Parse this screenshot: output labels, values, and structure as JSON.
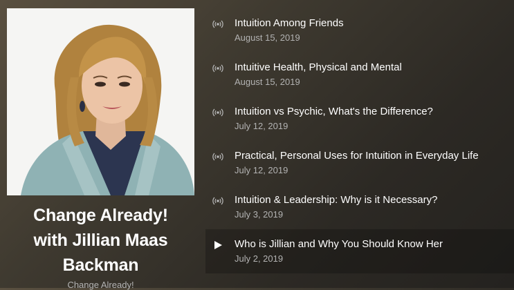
{
  "show": {
    "title_line1": "Change Already!",
    "title_line2": "with Jillian Maas",
    "title_line3": "Backman",
    "author": "Change Already!"
  },
  "episodes": [
    {
      "title": "Intuition Among Friends",
      "date": "August 15, 2019",
      "icon": "podcast-icon"
    },
    {
      "title": "Intuitive Health, Physical and Mental",
      "date": "August 15, 2019",
      "icon": "podcast-icon"
    },
    {
      "title": "Intuition vs Psychic, What's the Difference?",
      "date": "July 12, 2019",
      "icon": "podcast-icon"
    },
    {
      "title": "Practical, Personal Uses for Intuition in Everyday Life",
      "date": "July 12, 2019",
      "icon": "podcast-icon"
    },
    {
      "title": "Intuition & Leadership: Why is it Necessary?",
      "date": "July 3, 2019",
      "icon": "podcast-icon"
    },
    {
      "title": "Who is Jillian and Why You Should Know Her",
      "date": "July 2, 2019",
      "icon": "play-icon"
    }
  ],
  "colors": {
    "text_primary": "#ffffff",
    "text_secondary": "#b3b3b3",
    "background": "#3f3a30"
  }
}
